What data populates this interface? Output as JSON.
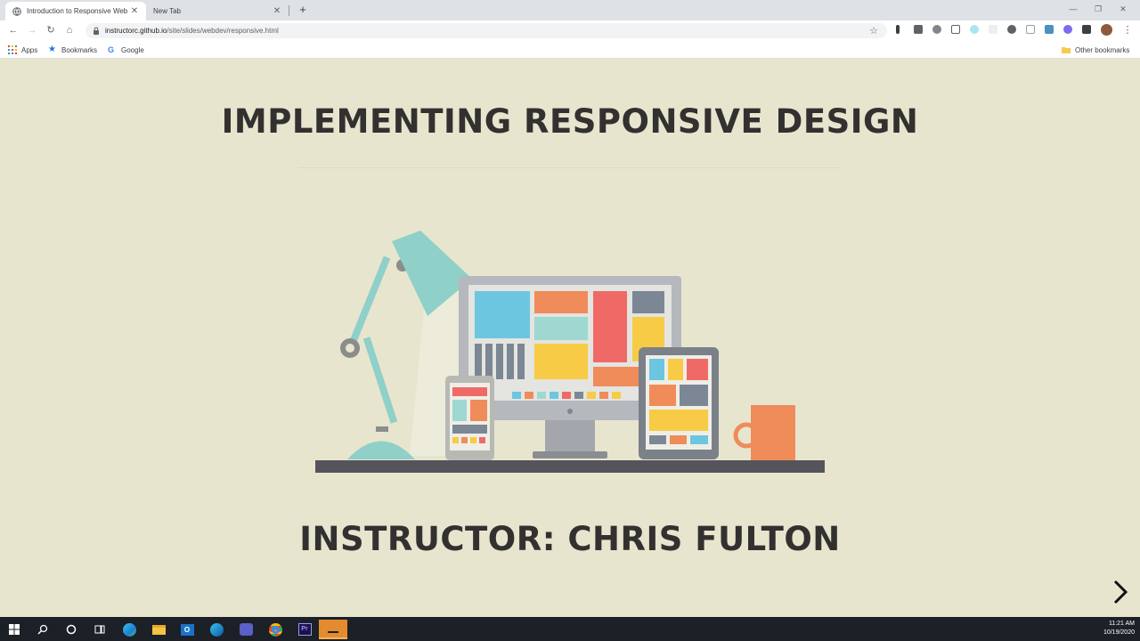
{
  "browser": {
    "tabs": [
      {
        "title": "Introduction to Responsive Web",
        "active": true
      },
      {
        "title": "New Tab",
        "active": false
      }
    ],
    "url_host": "instructorc.github.io",
    "url_path": "/site/slides/webdev/responsive.html",
    "bookmarks": [
      {
        "label": "Apps",
        "icon": "apps-grid-icon"
      },
      {
        "label": "Bookmarks",
        "icon": "star-icon"
      },
      {
        "label": "Google",
        "icon": "google-icon"
      }
    ],
    "other_bookmarks": "Other bookmarks"
  },
  "slide": {
    "title": "IMPLEMENTING RESPONSIVE DESIGN",
    "instructor": "INSTRUCTOR: CHRIS FULTON",
    "background": "#e8e5cf",
    "text_color": "#333130"
  },
  "taskbar": {
    "time": "11:21 AM",
    "date": "10/19/2020"
  }
}
